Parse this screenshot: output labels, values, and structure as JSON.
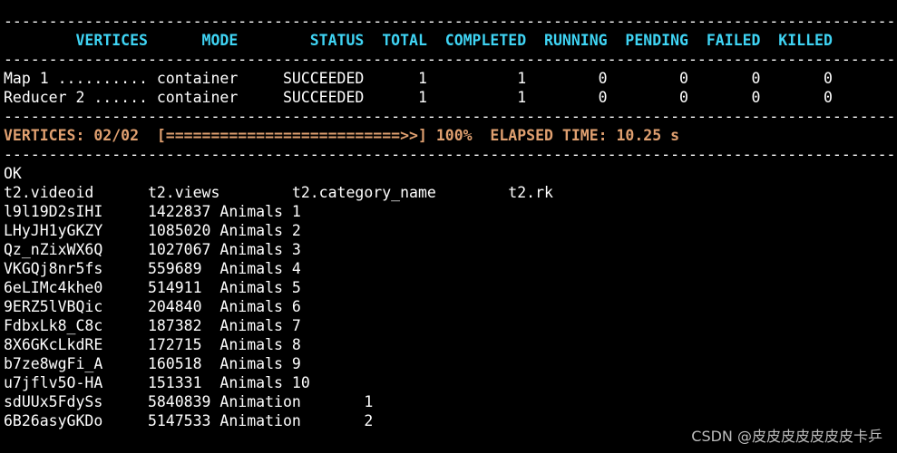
{
  "terminal": {
    "colors": {
      "background": "#000000",
      "text": "#ffffff",
      "header": "#3fd4f4",
      "progress": "#e0a070",
      "watermark": "#bdbdbd"
    },
    "lines": [
      {
        "kind": "separator",
        "text": "------------------------------------------------------------------------------------------------------------------------------"
      },
      {
        "kind": "header",
        "text": "        VERTICES      MODE        STATUS  TOTAL  COMPLETED  RUNNING  PENDING  FAILED  KILLED"
      },
      {
        "kind": "separator",
        "text": "------------------------------------------------------------------------------------------------------------------------------"
      },
      {
        "kind": "vertex-row",
        "text": "Map 1 .......... container     SUCCEEDED      1          1        0        0       0       0"
      },
      {
        "kind": "vertex-row",
        "text": "Reducer 2 ...... container     SUCCEEDED      1          1        0        0       0       0"
      },
      {
        "kind": "separator",
        "text": "------------------------------------------------------------------------------------------------------------------------------"
      },
      {
        "kind": "progress",
        "text": "VERTICES: 02/02  [==========================>>] 100%  ELAPSED TIME: 10.25 s"
      },
      {
        "kind": "separator",
        "text": "------------------------------------------------------------------------------------------------------------------------------"
      },
      {
        "kind": "status",
        "text": "OK"
      },
      {
        "kind": "columns",
        "text": "t2.videoid      t2.views        t2.category_name        t2.rk"
      },
      {
        "kind": "result-row",
        "text": "l9l19D2sIHI     1422837 Animals 1"
      },
      {
        "kind": "result-row",
        "text": "LHyJH1yGKZY     1085020 Animals 2"
      },
      {
        "kind": "result-row",
        "text": "Qz_nZixWX6Q     1027067 Animals 3"
      },
      {
        "kind": "result-row",
        "text": "VKGQj8nr5fs     559689  Animals 4"
      },
      {
        "kind": "result-row",
        "text": "6eLIMc4khe0     514911  Animals 5"
      },
      {
        "kind": "result-row",
        "text": "9ERZ5lVBQic     204840  Animals 6"
      },
      {
        "kind": "result-row",
        "text": "FdbxLk8_C8c     187382  Animals 7"
      },
      {
        "kind": "result-row",
        "text": "8X6GKcLkdRE     172715  Animals 8"
      },
      {
        "kind": "result-row",
        "text": "b7ze8wgFi_A     160518  Animals 9"
      },
      {
        "kind": "result-row",
        "text": "u7jflv5O-HA     151331  Animals 10"
      },
      {
        "kind": "result-row",
        "text": "sdUUx5FdySs     5840839 Animation       1"
      },
      {
        "kind": "result-row",
        "text": "6B26asyGKDo     5147533 Animation       2"
      }
    ]
  },
  "watermark": "CSDN @皮皮皮皮皮皮皮卡乒"
}
